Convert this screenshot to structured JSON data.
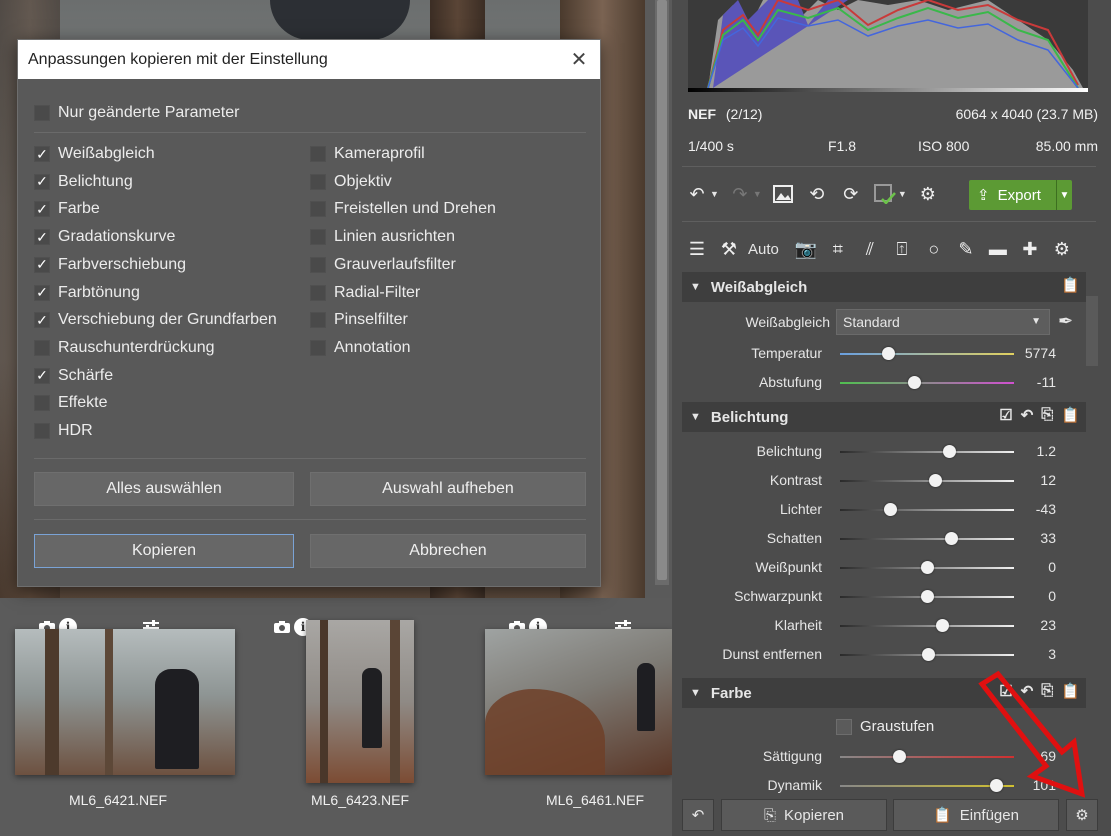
{
  "file_info": {
    "format": "NEF",
    "index": "(2/12)",
    "dimensions": "6064 x 4040 (23.7 MB)",
    "shutter": "1/400 s",
    "aperture": "F1.8",
    "iso": "ISO 800",
    "focal_length": "85.00 mm"
  },
  "toolbar": {
    "export_label": "Export",
    "auto_label": "Auto"
  },
  "dialog": {
    "title": "Anpassungen kopieren mit der Einstellung",
    "only_changed": {
      "label": "Nur geänderte Parameter",
      "checked": false
    },
    "left_items": [
      {
        "label": "Weißabgleich",
        "checked": true
      },
      {
        "label": "Belichtung",
        "checked": true
      },
      {
        "label": "Farbe",
        "checked": true
      },
      {
        "label": "Gradationskurve",
        "checked": true
      },
      {
        "label": "Farbverschiebung",
        "checked": true
      },
      {
        "label": "Farbtönung",
        "checked": true
      },
      {
        "label": "Verschiebung der Grundfarben",
        "checked": true
      },
      {
        "label": "Rauschunterdrückung",
        "checked": false
      },
      {
        "label": "Schärfe",
        "checked": true
      },
      {
        "label": "Effekte",
        "checked": false
      },
      {
        "label": "HDR",
        "checked": false
      }
    ],
    "right_items": [
      {
        "label": "Kameraprofil",
        "checked": false
      },
      {
        "label": "Objektiv",
        "checked": false
      },
      {
        "label": "Freistellen und Drehen",
        "checked": false
      },
      {
        "label": "Linien ausrichten",
        "checked": false
      },
      {
        "label": "Grauverlaufsfilter",
        "checked": false
      },
      {
        "label": "Radial-Filter",
        "checked": false
      },
      {
        "label": "Pinselfilter",
        "checked": false
      },
      {
        "label": "Annotation",
        "checked": false
      }
    ],
    "select_all": "Alles auswählen",
    "deselect": "Auswahl aufheben",
    "copy": "Kopieren",
    "cancel": "Abbrechen"
  },
  "filmstrip": [
    {
      "name": "ML6_6421.NEF"
    },
    {
      "name": "ML6_6423.NEF"
    },
    {
      "name": "ML6_6461.NEF"
    }
  ],
  "panel": {
    "white_balance": {
      "title": "Weißabgleich",
      "select_label": "Weißabgleich",
      "select_value": "Standard",
      "sliders": [
        {
          "label": "Temperatur",
          "value": "5774",
          "pos": 0.28
        },
        {
          "label": "Abstufung",
          "value": "-11",
          "pos": 0.43
        }
      ]
    },
    "exposure": {
      "title": "Belichtung",
      "sliders": [
        {
          "label": "Belichtung",
          "value": "1.2",
          "pos": 0.63
        },
        {
          "label": "Kontrast",
          "value": "12",
          "pos": 0.55
        },
        {
          "label": "Lichter",
          "value": "-43",
          "pos": 0.29
        },
        {
          "label": "Schatten",
          "value": "33",
          "pos": 0.64
        },
        {
          "label": "Weißpunkt",
          "value": "0",
          "pos": 0.5
        },
        {
          "label": "Schwarzpunkt",
          "value": "0",
          "pos": 0.5
        },
        {
          "label": "Klarheit",
          "value": "23",
          "pos": 0.59
        },
        {
          "label": "Dunst entfernen",
          "value": "3",
          "pos": 0.51
        }
      ]
    },
    "color": {
      "title": "Farbe",
      "grayscale_label": "Graustufen",
      "sliders": [
        {
          "label": "Sättigung",
          "value": "69",
          "pos": 0.34
        },
        {
          "label": "Dynamik",
          "value": "101",
          "pos": 0.9
        }
      ]
    }
  },
  "bottom": {
    "copy": "Kopieren",
    "paste": "Einfügen"
  },
  "colors": {
    "accent_green": "#5c9a34",
    "arrow_red": "#e01010",
    "dialog_bg": "#595959"
  }
}
